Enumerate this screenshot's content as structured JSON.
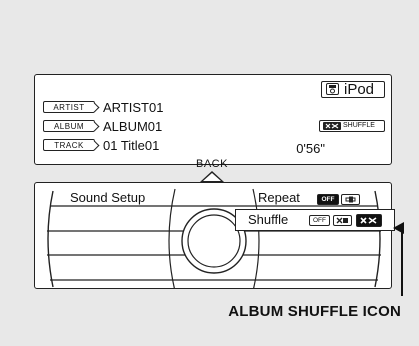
{
  "display": {
    "ipod_label": "iPod",
    "rows": [
      {
        "tag": "ARTIST",
        "value": "ARTIST01"
      },
      {
        "tag": "ALBUM",
        "value": "ALBUM01"
      },
      {
        "tag": "TRACK",
        "value": "01 Title01"
      }
    ],
    "time": "0'56\"",
    "shuffle_badge": "SHUFFLE"
  },
  "back_label": "BACK",
  "menu": {
    "sound_setup": "Sound Setup",
    "repeat": "Repeat",
    "repeat_off": "OFF",
    "shuffle": "Shuffle",
    "shuffle_off": "OFF"
  },
  "callout": "ALBUM SHUFFLE ICON"
}
